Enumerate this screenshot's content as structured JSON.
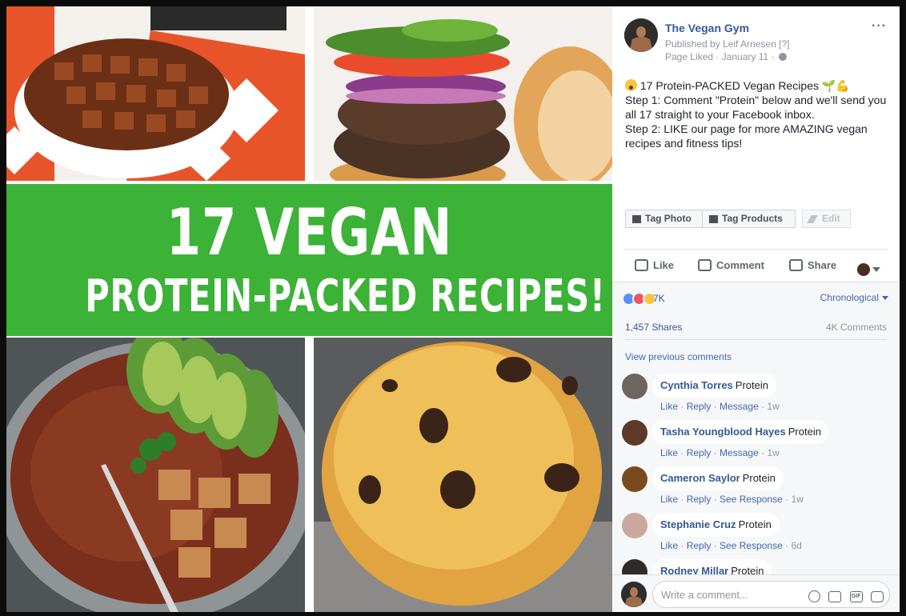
{
  "photo": {
    "headline_line1": "17 VEGAN",
    "headline_line2": "PROTEIN-PACKED RECIPES!",
    "colors": {
      "banner": "#3cb237"
    }
  },
  "post": {
    "page_name": "The Vegan Gym",
    "published_by": "Published by Leif Arnesen",
    "published_marker": "[?]",
    "liked_status": "Page Liked · January 11 ·",
    "text_line1": " 17 Protein-PACKED Vegan Recipes 🌱💪",
    "text_line2": "Step 1: Comment \"Protein\" below and we'll send you all 17 straight to your Facebook inbox.",
    "text_line3": "Step 2: LIKE our page for more AMAZING vegan recipes and fitness tips!"
  },
  "toolbar": {
    "tag_photo": "Tag Photo",
    "tag_products": "Tag Products",
    "edit": "Edit"
  },
  "actions": {
    "like": "Like",
    "comment": "Comment",
    "share": "Share"
  },
  "stats": {
    "reactions_count": "7K",
    "sort_label": "Chronological",
    "shares": "1,457 Shares",
    "comments": "4K Comments",
    "view_previous": "View previous comments"
  },
  "comments": [
    {
      "name": "Cynthia Torres",
      "text": "Protein",
      "link1": "Like",
      "link2": "Reply",
      "link3": "Message",
      "time": "1w"
    },
    {
      "name": "Tasha Youngblood Hayes",
      "text": "Protein",
      "link1": "Like",
      "link2": "Reply",
      "link3": "Message",
      "time": "1w"
    },
    {
      "name": "Cameron Saylor",
      "text": "Protein",
      "link1": "Like",
      "link2": "Reply",
      "link3": "See Response",
      "time": "1w"
    },
    {
      "name": "Stephanie Cruz",
      "text": "Protein",
      "link1": "Like",
      "link2": "Reply",
      "link3": "See Response",
      "time": "6d"
    },
    {
      "name": "Rodney Millar",
      "text": "Protein",
      "link1": "",
      "link2": "",
      "link3": "",
      "time": ""
    }
  ],
  "composer": {
    "placeholder": "Write a comment...",
    "gif_label": "GIF"
  }
}
